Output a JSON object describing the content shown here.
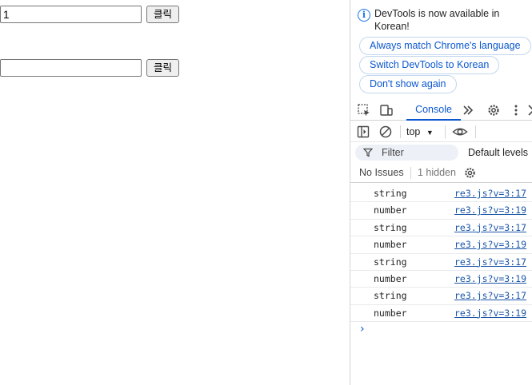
{
  "page": {
    "input1_value": "1",
    "button1_label": "클릭",
    "input2_value": "",
    "button2_label": "클릭"
  },
  "devtools": {
    "notice": {
      "message": "DevTools is now available in Korean!",
      "btn_match": "Always match Chrome's language",
      "btn_switch": "Switch DevTools to Korean",
      "btn_dont_show": "Don't show again"
    },
    "tabs": {
      "console_label": "Console"
    },
    "toolbar": {
      "context": "top"
    },
    "filter": {
      "placeholder": "Filter",
      "levels": "Default levels"
    },
    "issues": {
      "label": "No Issues",
      "hidden": "1 hidden"
    },
    "log": [
      {
        "message": "string",
        "source": "re3.js?v=3:17"
      },
      {
        "message": "number",
        "source": "re3.js?v=3:19"
      },
      {
        "message": "string",
        "source": "re3.js?v=3:17"
      },
      {
        "message": "number",
        "source": "re3.js?v=3:19"
      },
      {
        "message": "string",
        "source": "re3.js?v=3:17"
      },
      {
        "message": "number",
        "source": "re3.js?v=3:19"
      },
      {
        "message": "string",
        "source": "re3.js?v=3:17"
      },
      {
        "message": "number",
        "source": "re3.js?v=3:19"
      }
    ],
    "prompt_symbol": "›"
  },
  "colors": {
    "accent": "#0b57d0",
    "link": "#1a55a8",
    "filter_bg": "#edf0f6"
  },
  "icons": {
    "info": "info-icon",
    "inspect": "inspect-element-icon",
    "device": "device-toolbar-icon",
    "more_tabs": "more-tabs-icon",
    "settings": "gear-icon",
    "menu": "kebab-menu-icon",
    "sidebar": "sidebar-toggle-icon",
    "clear": "clear-console-icon",
    "eye": "eye-icon",
    "filter": "filter-icon",
    "issues_settings": "gear-icon"
  }
}
